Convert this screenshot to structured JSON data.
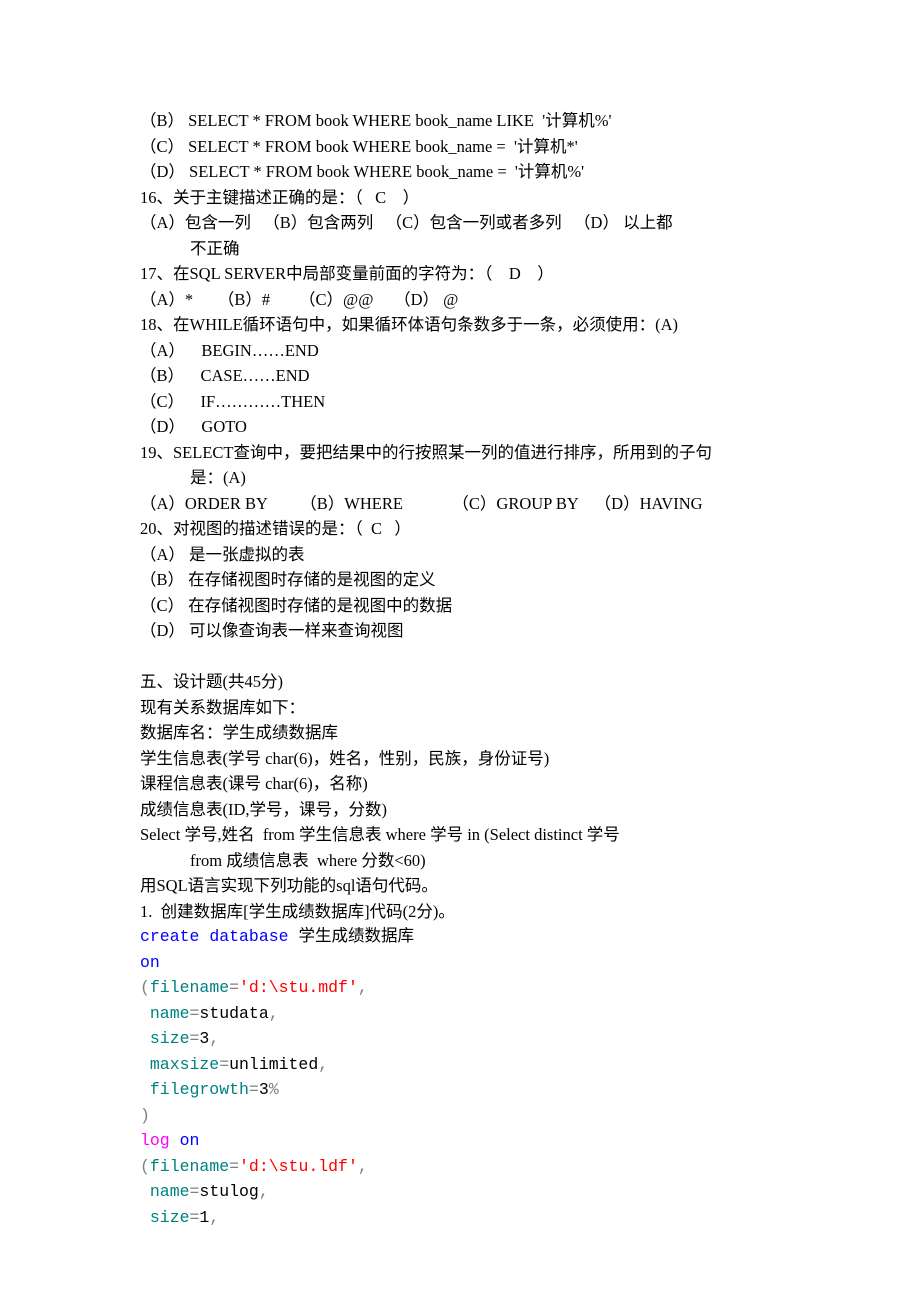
{
  "lines": {
    "l1": "（B） SELECT * FROM book WHERE book_name LIKE  '计算机%'",
    "l2": "（C） SELECT * FROM book WHERE book_name =  '计算机*'",
    "l3": "（D） SELECT * FROM book WHERE book_name =  '计算机%'",
    "l4": "16、关于主键描述正确的是：（   C    ）",
    "l5": "（A）包含一列   （B）包含两列   （C）包含一列或者多列   （D） 以上都",
    "l5b": "不正确",
    "l6": "17、在SQL SERVER中局部变量前面的字符为：（    D    ）",
    "l7": "（A）*      （B）#       （C）@@     （D） @",
    "l8": "18、在WHILE循环语句中，如果循环体语句条数多于一条，必须使用：(A)",
    "l9": "（A）    BEGIN……END",
    "l10": "（B）    CASE……END",
    "l11": "（C）    IF…………THEN",
    "l12": "（D）    GOTO",
    "l13": "19、SELECT查询中，要把结果中的行按照某一列的值进行排序，所用到的子句",
    "l13b": "是：(A)",
    "l14": "（A）ORDER BY        （B）WHERE            （C）GROUP BY    （D）HAVING",
    "l15": "20、对视图的描述错误的是：（  C   ）",
    "l16": "（A） 是一张虚拟的表",
    "l17": "（B） 在存储视图时存储的是视图的定义",
    "l18": "（C） 在存储视图时存储的是视图中的数据",
    "l19": "（D） 可以像查询表一样来查询视图",
    "blank1": " ",
    "l20": "五、设计题(共45分)",
    "l21": "现有关系数据库如下：",
    "l22": "数据库名：学生成绩数据库",
    "l23": "学生信息表(学号 char(6)，姓名，性别，民族，身份证号)",
    "l24": "课程信息表(课号 char(6)，名称)",
    "l25": "成绩信息表(ID,学号，课号，分数)",
    "l26": "Select 学号,姓名  from 学生信息表 where 学号 in (Select distinct 学号 ",
    "l26b": "from 成绩信息表  where 分数<60)",
    "l27": "用SQL语言实现下列功能的sql语句代码。",
    "l28": "1.  创建数据库[学生成绩数据库]代码(2分)。"
  },
  "code": {
    "c1a": "create",
    "c1b": " database",
    "c1c": " 学生成绩数据库",
    "c2a": "on",
    "c3a": "(",
    "c3b": "filename",
    "c3c": "=",
    "c3d": "'d:\\stu.mdf'",
    "c3e": ",",
    "c4a": " name",
    "c4b": "=",
    "c4c": "studata",
    "c4d": ",",
    "c5a": " size",
    "c5b": "=",
    "c5c": "3",
    "c5d": ",",
    "c6a": " maxsize",
    "c6b": "=",
    "c6c": "unlimited",
    "c6d": ",",
    "c7a": " filegrowth",
    "c7b": "=",
    "c7c": "3",
    "c7d": "%",
    "c8a": ")",
    "c9a": "log",
    "c9b": " on",
    "c10a": "(",
    "c10b": "filename",
    "c10c": "=",
    "c10d": "'d:\\stu.ldf'",
    "c10e": ",",
    "c11a": " name",
    "c11b": "=",
    "c11c": "stulog",
    "c11d": ",",
    "c12a": " size",
    "c12b": "=",
    "c12c": "1",
    "c12d": ","
  }
}
